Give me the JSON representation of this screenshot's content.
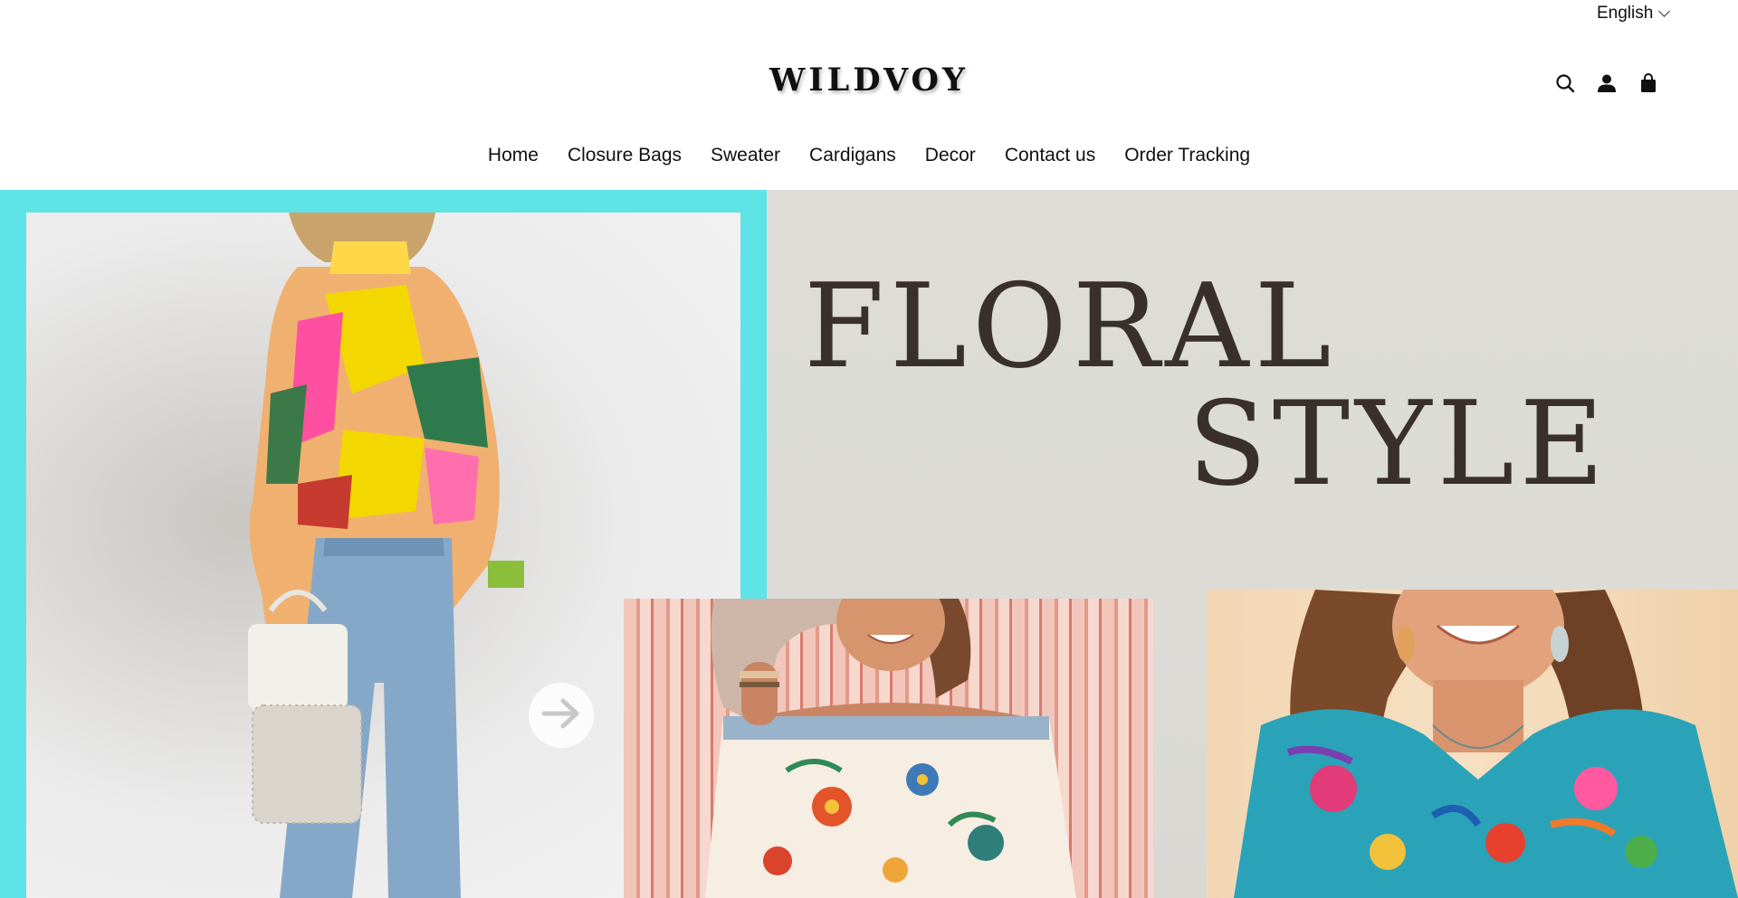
{
  "language": {
    "selected": "English"
  },
  "header": {
    "logo_text": "WILDVOY",
    "icons": [
      "search-icon",
      "account-icon",
      "cart-icon"
    ]
  },
  "nav": {
    "items": [
      "Home",
      "Closure Bags",
      "Sweater",
      "Cardigans",
      "Decor",
      "Contact us",
      "Order Tracking"
    ]
  },
  "hero": {
    "title_line1": "FLORAL",
    "title_line2": "STYLE",
    "accent_cyan": "#5ee3e6",
    "title_color": "#3a302b"
  }
}
